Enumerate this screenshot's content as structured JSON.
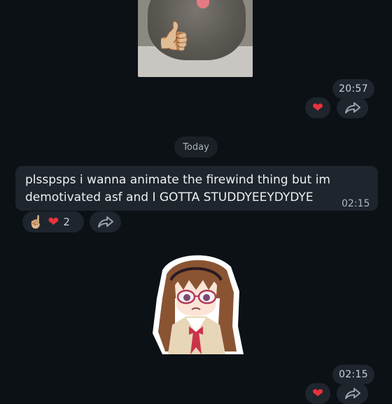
{
  "conversation": {
    "messages": [
      {
        "type": "sticker",
        "sticker_icon": "cat-thumbs-up-sticker",
        "time": "20:57",
        "reactions": [
          {
            "icon": "heart",
            "emoji": "❤️"
          }
        ]
      },
      {
        "type": "date-separator",
        "label": "Today"
      },
      {
        "type": "text",
        "text": "plsspsps i wanna animate the firewind thing but im demotivated asf and I GOTTA STUDDYEEYDYDYE",
        "time": "02:15",
        "reactions": [
          {
            "icon": "point-up",
            "emoji": "☝️"
          },
          {
            "icon": "heart",
            "emoji": "❤️"
          }
        ],
        "reaction_count": "2"
      },
      {
        "type": "sticker",
        "sticker_icon": "anime-girl-sticker",
        "time": "02:15"
      }
    ]
  },
  "colors": {
    "background": "#0c1116",
    "bubble": "#1e252c",
    "heart": "#e8323c",
    "text": "#edf1f4"
  }
}
